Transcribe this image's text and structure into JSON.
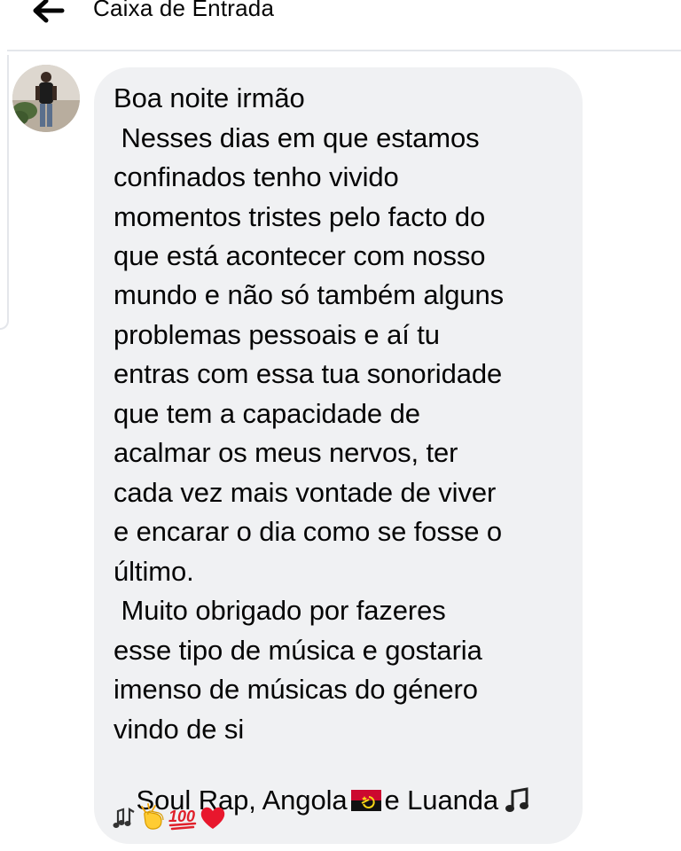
{
  "header": {
    "back_icon": "arrow-left-icon",
    "title": "Caixa de Entrada"
  },
  "sender": {
    "avatar_icon": "avatar-photo"
  },
  "message": {
    "lines": [
      "Boa noite irmão",
      " Nesses dias em que estamos",
      "confinados tenho vivido",
      "momentos tristes pelo facto do",
      "que está acontecer com nosso",
      "mundo e não só também alguns",
      "problemas pessoais e aí tu",
      "entras com essa tua sonoridade",
      "que tem a capacidade de",
      "acalmar os meus nervos, ter",
      "cada vez mais vontade de viver",
      "e encarar o dia como se fosse o",
      "último.",
      " Muito obrigado por fazeres",
      "esse tipo de música e gostaria",
      "imenso de músicas do género",
      "vindo de si"
    ],
    "last_line": {
      "part1": " Soul Rap, Angola",
      "part2": "e Luanda"
    },
    "emojis": [
      "flag-angola-emoji",
      "musical-note-emoji",
      "musical-notes-emoji",
      "clapping-hands-emoji",
      "hundred-points-emoji",
      "red-heart-emoji"
    ]
  },
  "colors": {
    "bubble": "#f0f1f3",
    "text": "#050505",
    "divider": "#e4e6eb"
  }
}
